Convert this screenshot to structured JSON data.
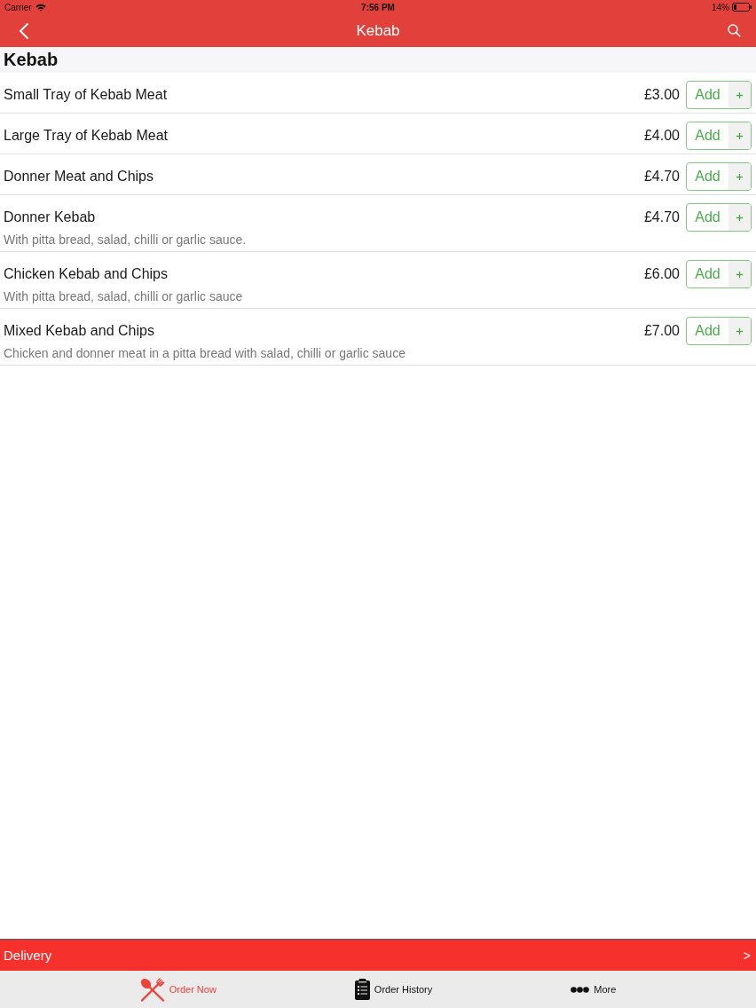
{
  "status_bar": {
    "carrier": "Carrier",
    "time": "7:56 PM",
    "battery": "14%"
  },
  "nav_bar": {
    "title": "Kebab"
  },
  "section": {
    "title": "Kebab"
  },
  "items": [
    {
      "name": "Small Tray of Kebab Meat",
      "price": "£3.00",
      "button": "Add"
    },
    {
      "name": "Large Tray of Kebab Meat",
      "price": "£4.00",
      "button": "Add"
    },
    {
      "name": "Donner Meat and Chips",
      "price": "£4.70",
      "button": "Add"
    },
    {
      "name": "Donner Kebab",
      "description": "With pitta bread, salad, chilli or garlic sauce.",
      "price": "£4.70",
      "button": "Add"
    },
    {
      "name": "Chicken Kebab and Chips",
      "description": "With pitta bread, salad, chilli or garlic sauce",
      "price": "£6.00",
      "button": "Add"
    },
    {
      "name": "Mixed Kebab and Chips",
      "description": "Chicken and donner meat in a pitta bread with salad, chilli or garlic sauce",
      "price": "£7.00",
      "button": "Add"
    }
  ],
  "delivery_bar": {
    "label": "Delivery",
    "chevron": ">"
  },
  "tabs": [
    {
      "label": "Order Now",
      "selected": true
    },
    {
      "label": "Order History",
      "selected": false
    },
    {
      "label": "More",
      "selected": false
    }
  ]
}
